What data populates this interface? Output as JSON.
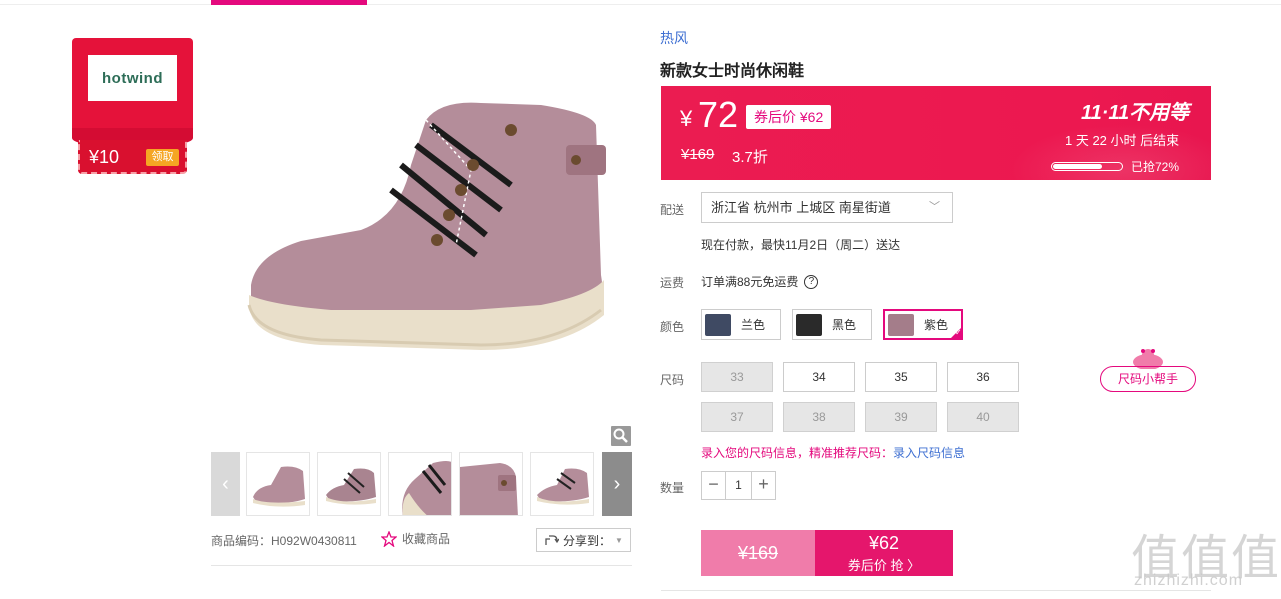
{
  "coupon": {
    "logo_text": "hotwind",
    "amount": "¥10",
    "claim_label": "领取"
  },
  "product": {
    "brand": "热风",
    "title": "新款女士时尚休闲鞋",
    "sku_text": "商品编码：H092W0430811",
    "favorite_label": "收藏商品",
    "share_label": "分享到："
  },
  "price": {
    "currency": "¥",
    "value": "72",
    "coupon_price": "券后价 ¥62",
    "original": "¥169",
    "discount": "3.7折",
    "promo": "11·11不用等",
    "countdown": "1  天 22 小时 后结束",
    "sold_percent": 72,
    "sold_text": "已抢72%"
  },
  "labels": {
    "delivery": "配送",
    "freight": "运费",
    "color": "颜色",
    "size": "尺码",
    "quantity": "数量"
  },
  "delivery": {
    "address": "浙江省 杭州市 上城区 南星街道",
    "eta": "现在付款，最快11月2日（周二）送达"
  },
  "freight": {
    "text": "订单满88元免运费",
    "help_icon": "?"
  },
  "colors": [
    {
      "label": "兰色",
      "swatch": "#3f4a63",
      "selected": false
    },
    {
      "label": "黑色",
      "swatch": "#2a2a2a",
      "selected": false
    },
    {
      "label": "紫色",
      "swatch": "#a47d8a",
      "selected": true
    }
  ],
  "sizes": [
    {
      "label": "33",
      "available": false
    },
    {
      "label": "34",
      "available": true
    },
    {
      "label": "35",
      "available": true
    },
    {
      "label": "36",
      "available": true
    },
    {
      "label": "37",
      "available": false
    },
    {
      "label": "38",
      "available": false
    },
    {
      "label": "39",
      "available": false
    },
    {
      "label": "40",
      "available": false
    }
  ],
  "size_helper": "尺码小帮手",
  "size_info": {
    "text": "录入您的尺码信息，精准推荐尺码：",
    "link": "录入尺码信息"
  },
  "quantity": {
    "value": "1",
    "minus": "−",
    "plus": "+"
  },
  "buy": {
    "original_price": "¥169",
    "coupon_price": "¥62",
    "coupon_label": "券后价 抢 〉"
  },
  "watermark": {
    "big": "值值值",
    "small": "zhizhizhi.com"
  },
  "colors_theme": {
    "accent": "#e4097d",
    "price_bg": "#eb1c51",
    "link": "#3e6fd2"
  }
}
